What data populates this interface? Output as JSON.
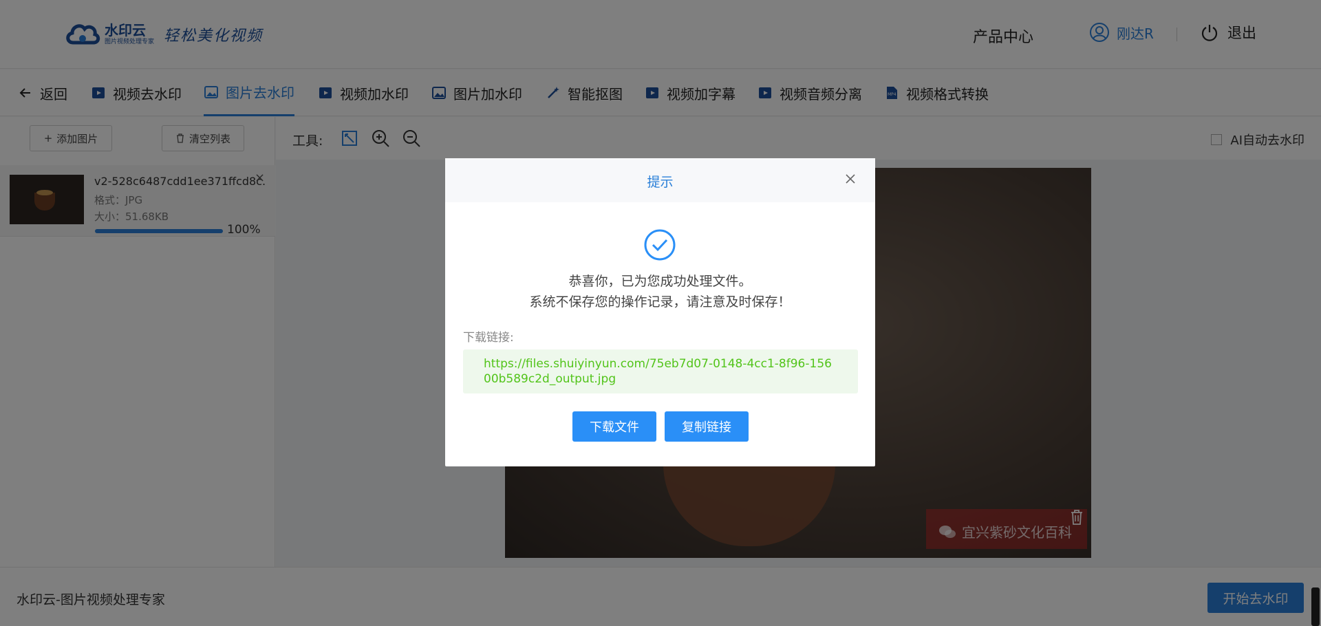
{
  "header": {
    "logo_name": "水印云",
    "logo_sub": "图片视频处理专家",
    "logo_slogan": "轻松美化视频",
    "product_center": "产品中心",
    "user_name": "刚达R",
    "logout": "退出"
  },
  "tabs": [
    {
      "label": "返回",
      "icon": "back-arrow-icon"
    },
    {
      "label": "视频去水印",
      "icon": "video-icon"
    },
    {
      "label": "图片去水印",
      "icon": "image-icon",
      "active": true
    },
    {
      "label": "视频加水印",
      "icon": "video-icon"
    },
    {
      "label": "图片加水印",
      "icon": "image-icon"
    },
    {
      "label": "智能抠图",
      "icon": "magic-wand-icon"
    },
    {
      "label": "视频加字幕",
      "icon": "video-icon"
    },
    {
      "label": "视频音频分离",
      "icon": "video-icon"
    },
    {
      "label": "视频格式转换",
      "icon": "mp4-file-icon"
    }
  ],
  "left_panel": {
    "add_image": "添加图片",
    "clear_list": "清空列表",
    "file": {
      "name": "v2-528c6487cdd1ee371ffcd8c...",
      "format": "格式：JPG",
      "size": "大小：51.68KB",
      "progress_percent": 100,
      "progress_text": "100%"
    }
  },
  "toolbar": {
    "label": "工具:",
    "ai_auto": "AI自动去水印"
  },
  "canvas": {
    "watermark_text": "宜兴紫砂文化百科"
  },
  "bottom": {
    "brand_text": "水印云-图片视频处理专家",
    "start_button": "开始去水印"
  },
  "modal": {
    "title": "提示",
    "message_line1": "恭喜你，已为您成功处理文件。",
    "message_line2": "系统不保存您的操作记录，请注意及时保存！",
    "download_label": "下载链接:",
    "download_link": "https://files.shuiyinyun.com/75eb7d07-0148-4cc1-8f96-15600b589c2d_output.jpg",
    "download_button": "下载文件",
    "copy_button": "复制链接"
  },
  "colors": {
    "accent": "#2a7fd8",
    "button": "#2a8ff7",
    "link_green": "#52c41a",
    "link_bg": "#eef8ec"
  }
}
